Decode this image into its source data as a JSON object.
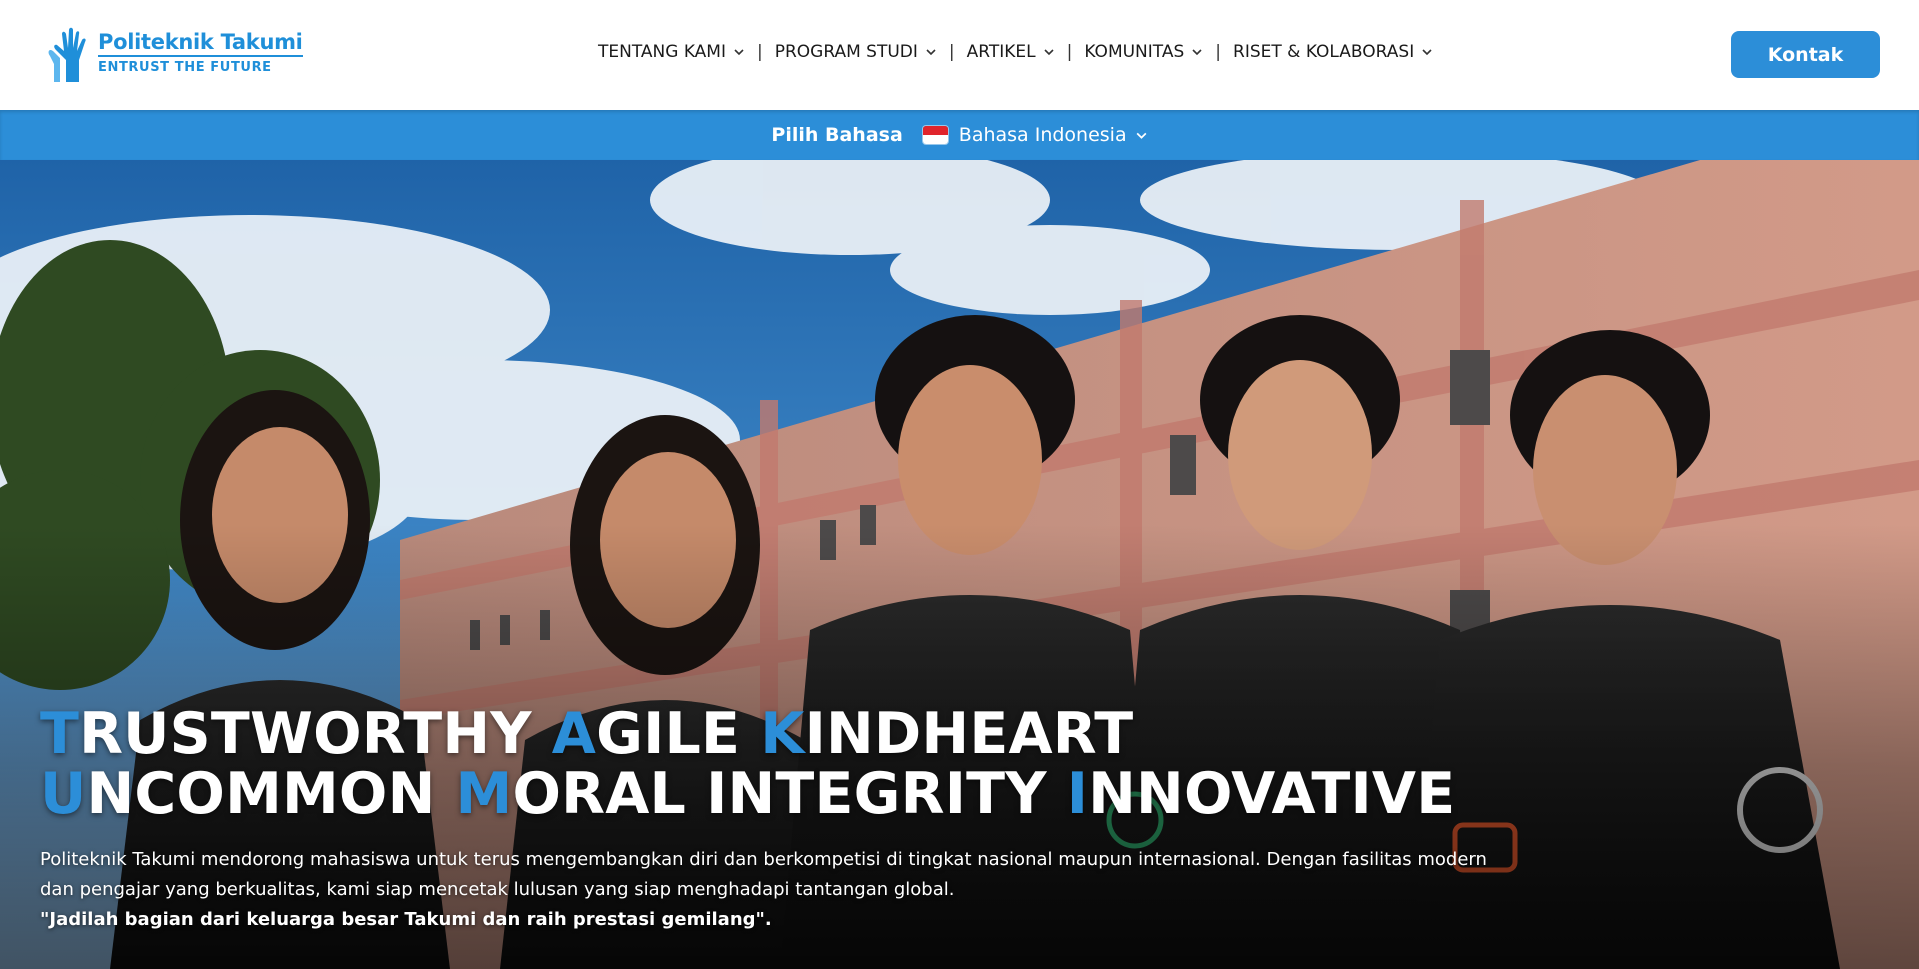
{
  "brand": {
    "name": "Politeknik Takumi",
    "tagline": "ENTRUST THE FUTURE",
    "accent_color": "#2c8ed8"
  },
  "nav": {
    "items": [
      {
        "label": "TENTANG KAMI",
        "icon": "chevron-down-icon"
      },
      {
        "label": "PROGRAM STUDI",
        "icon": "chevron-down-icon"
      },
      {
        "label": "ARTIKEL",
        "icon": "chevron-down-icon"
      },
      {
        "label": "KOMUNITAS",
        "icon": "chevron-down-icon"
      },
      {
        "label": "RISET & KOLABORASI",
        "icon": "chevron-down-icon"
      }
    ],
    "separator": "|"
  },
  "header": {
    "contact_label": "Kontak"
  },
  "language": {
    "label": "Pilih Bahasa",
    "selected": "Bahasa Indonesia",
    "flag_icon": "indonesia-flag-icon"
  },
  "hero": {
    "line1": [
      {
        "initial": "T",
        "rest": "RUSTWORTHY "
      },
      {
        "initial": "A",
        "rest": "GILE "
      },
      {
        "initial": "K",
        "rest": "INDHEART"
      }
    ],
    "line2": [
      {
        "initial": "U",
        "rest": "NCOMMON "
      },
      {
        "initial": "M",
        "rest": "ORAL INTEGRITY "
      },
      {
        "initial": "I",
        "rest": "NNOVATIVE"
      }
    ],
    "description": "Politeknik Takumi mendorong mahasiswa untuk terus mengembangkan diri dan berkompetisi di tingkat nasional maupun internasional. Dengan fasilitas modern dan pengajar yang berkualitas, kami siap mencetak lulusan yang siap menghadapi tantangan global.",
    "quote": "\"Jadilah bagian dari keluarga besar Takumi dan raih prestasi gemilang\"."
  }
}
